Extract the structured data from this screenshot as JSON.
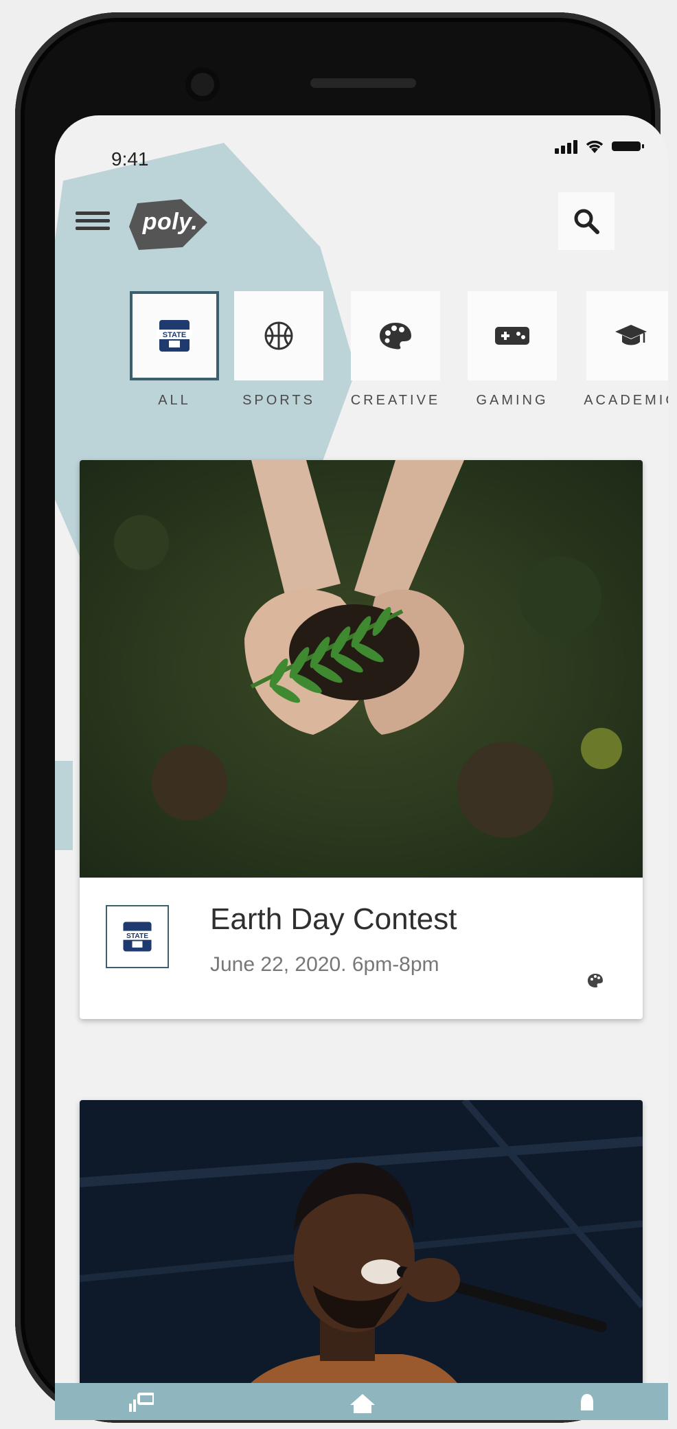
{
  "status_bar": {
    "time": "9:41"
  },
  "header": {
    "logo_text": "poly."
  },
  "categories": [
    {
      "label": "ALL",
      "icon": "usu-logo-icon",
      "selected": true
    },
    {
      "label": "SPORTS",
      "icon": "basketball-icon",
      "selected": false
    },
    {
      "label": "CREATIVE",
      "icon": "palette-icon",
      "selected": false
    },
    {
      "label": "GAMING",
      "icon": "gamepad-icon",
      "selected": false
    },
    {
      "label": "ACADEMIC",
      "icon": "graduation-cap-icon",
      "selected": false
    }
  ],
  "events": [
    {
      "title": "Earth Day Contest",
      "date": "June 22, 2020. 6pm-8pm",
      "image": "hands holding a fern seedling over leaf litter"
    },
    {
      "title": "",
      "date": "",
      "image": "man singing into a microphone on stage"
    }
  ],
  "bottom_nav": [
    "dashboard-icon",
    "home-icon",
    "bell-icon"
  ],
  "colors": {
    "accent": "#3c5f6d",
    "blob": "#bcd3d8",
    "nav": "#8fb5bf",
    "logo_bg": "#555555"
  }
}
